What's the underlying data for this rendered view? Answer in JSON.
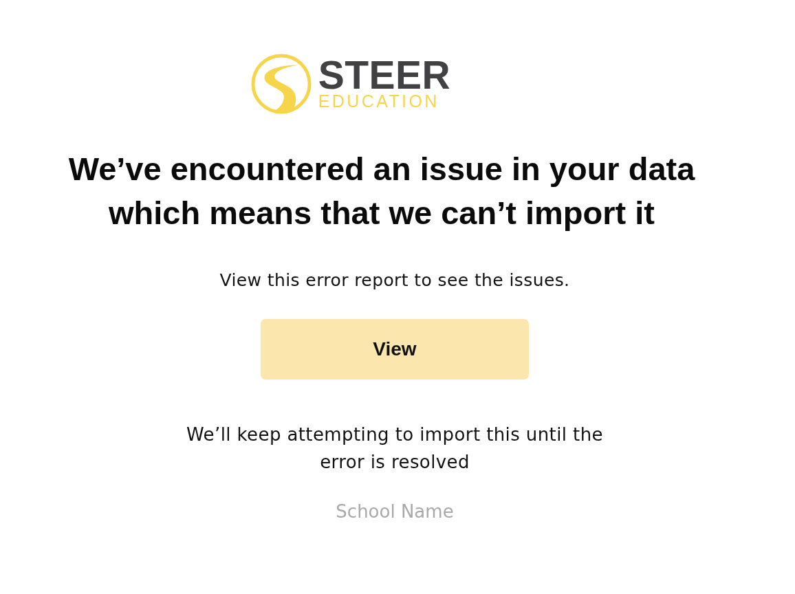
{
  "logo": {
    "name": "STEER",
    "subtitle": "EDUCATION"
  },
  "heading": "We’ve encountered an issue in your data\nwhich means that we can’t import it",
  "message": "View this error report to see the issues.",
  "button": {
    "label": "View"
  },
  "note": "We’ll keep attempting to import this until the\nerror is resolved",
  "school_name": "School Name"
}
